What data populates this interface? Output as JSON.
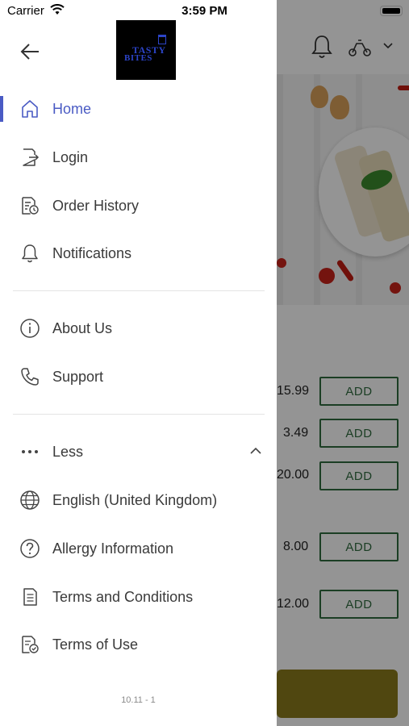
{
  "status_bar": {
    "carrier": "Carrier",
    "time": "3:59 PM"
  },
  "brand": {
    "logo_line1": "TASTY",
    "logo_line2": "BITES",
    "accent_color": "#4a5bc4"
  },
  "menu": {
    "home": "Home",
    "login": "Login",
    "order_history": "Order History",
    "notifications": "Notifications",
    "about_us": "About Us",
    "support": "Support",
    "less": "Less",
    "language": "English (United Kingdom)",
    "allergy": "Allergy Information",
    "terms_conditions": "Terms and Conditions",
    "terms_use": "Terms of Use"
  },
  "version": "10.11 - 1",
  "background": {
    "items": [
      {
        "price": "15.99",
        "button": "ADD"
      },
      {
        "price": "3.49",
        "button": "ADD"
      },
      {
        "price": "20.00",
        "button": "ADD"
      },
      {
        "price": "8.00",
        "button": "ADD"
      },
      {
        "price": "12.00",
        "button": "ADD"
      }
    ]
  }
}
